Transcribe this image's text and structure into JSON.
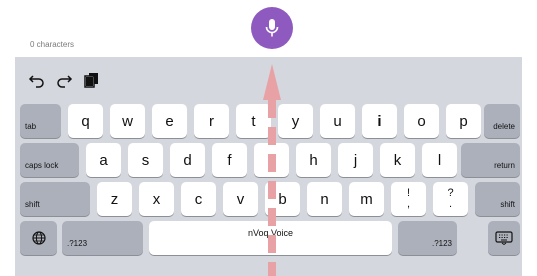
{
  "editor": {
    "char_count": "0 characters"
  },
  "mic": {
    "icon": "microphone-icon",
    "color": "#8f5ac0"
  },
  "toolbar": {
    "icons": [
      "undo-icon",
      "redo-icon",
      "paste-icon"
    ]
  },
  "keyboard": {
    "row1": {
      "tab": "tab",
      "keys": [
        "q",
        "w",
        "e",
        "r",
        "t",
        "y",
        "u",
        "i",
        "o",
        "p"
      ],
      "delete": "delete"
    },
    "row2": {
      "caps": "caps lock",
      "keys": [
        "a",
        "s",
        "d",
        "f",
        "g",
        "h",
        "j",
        "k",
        "l"
      ],
      "return": "return"
    },
    "row3": {
      "shift_left": "shift",
      "keys": [
        "z",
        "x",
        "c",
        "v",
        "b",
        "n",
        "m"
      ],
      "punct1_top": "!",
      "punct1_bottom": ",",
      "punct2_top": "?",
      "punct2_bottom": ".",
      "shift_right": "shift"
    },
    "row4": {
      "globe": "globe-icon",
      "num_left": ".?123",
      "space": "nVoq Voice",
      "num_right": ".?123",
      "hide": "keyboard-hide-icon"
    }
  },
  "colors": {
    "keyboard_bg": "#d5d7de",
    "special_key": "#acb0ba",
    "arrow": "#e8a2a6"
  }
}
